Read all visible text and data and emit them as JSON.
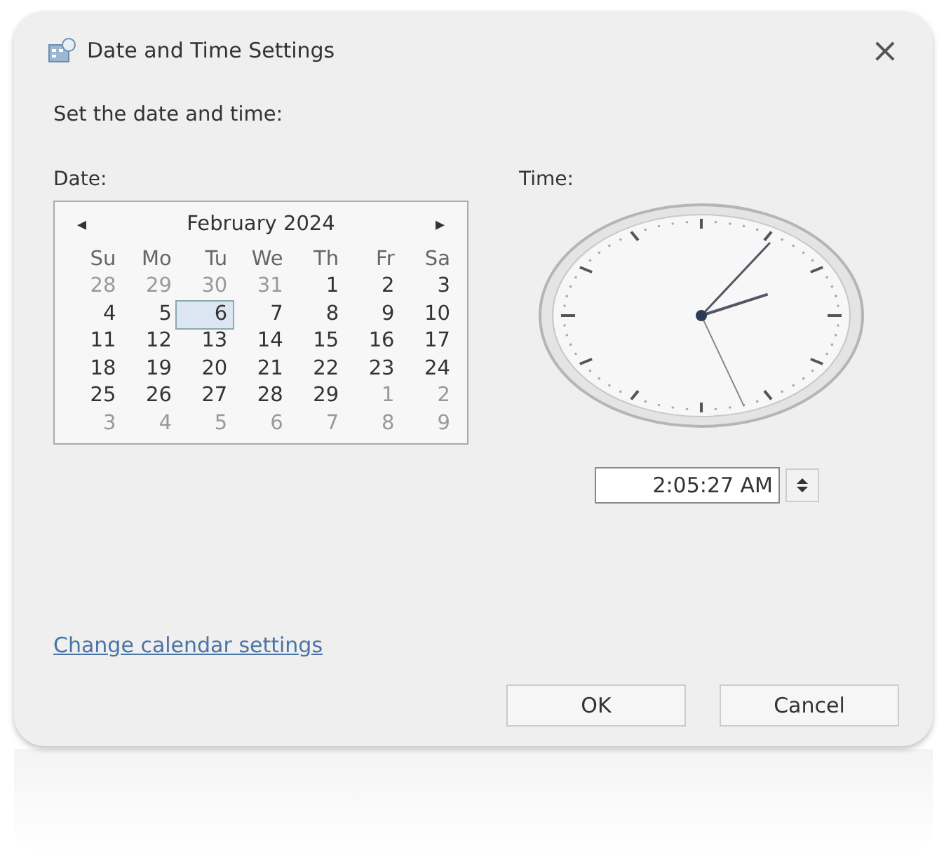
{
  "window": {
    "title": "Date and Time Settings",
    "close": "×"
  },
  "prompt": "Set the date and time:",
  "date": {
    "label": "Date:",
    "prev": "◂",
    "next": "▸",
    "month": "February 2024",
    "weekdays": [
      "Su",
      "Mo",
      "Tu",
      "We",
      "Th",
      "Fr",
      "Sa"
    ],
    "weeks": [
      [
        {
          "day": "28",
          "dimmed": true,
          "selected": false
        },
        {
          "day": "29",
          "dimmed": true,
          "selected": false
        },
        {
          "day": "30",
          "dimmed": true,
          "selected": false
        },
        {
          "day": "31",
          "dimmed": true,
          "selected": false
        },
        {
          "day": "1",
          "dimmed": false,
          "selected": false
        },
        {
          "day": "2",
          "dimmed": false,
          "selected": false
        },
        {
          "day": "3",
          "dimmed": false,
          "selected": false
        }
      ],
      [
        {
          "day": "4",
          "dimmed": false,
          "selected": false
        },
        {
          "day": "5",
          "dimmed": false,
          "selected": false
        },
        {
          "day": "6",
          "dimmed": false,
          "selected": true
        },
        {
          "day": "7",
          "dimmed": false,
          "selected": false
        },
        {
          "day": "8",
          "dimmed": false,
          "selected": false
        },
        {
          "day": "9",
          "dimmed": false,
          "selected": false
        },
        {
          "day": "10",
          "dimmed": false,
          "selected": false
        }
      ],
      [
        {
          "day": "11",
          "dimmed": false,
          "selected": false
        },
        {
          "day": "12",
          "dimmed": false,
          "selected": false
        },
        {
          "day": "13",
          "dimmed": false,
          "selected": false
        },
        {
          "day": "14",
          "dimmed": false,
          "selected": false
        },
        {
          "day": "15",
          "dimmed": false,
          "selected": false
        },
        {
          "day": "16",
          "dimmed": false,
          "selected": false
        },
        {
          "day": "17",
          "dimmed": false,
          "selected": false
        }
      ],
      [
        {
          "day": "18",
          "dimmed": false,
          "selected": false
        },
        {
          "day": "19",
          "dimmed": false,
          "selected": false
        },
        {
          "day": "20",
          "dimmed": false,
          "selected": false
        },
        {
          "day": "21",
          "dimmed": false,
          "selected": false
        },
        {
          "day": "22",
          "dimmed": false,
          "selected": false
        },
        {
          "day": "23",
          "dimmed": false,
          "selected": false
        },
        {
          "day": "24",
          "dimmed": false,
          "selected": false
        }
      ],
      [
        {
          "day": "25",
          "dimmed": false,
          "selected": false
        },
        {
          "day": "26",
          "dimmed": false,
          "selected": false
        },
        {
          "day": "27",
          "dimmed": false,
          "selected": false
        },
        {
          "day": "28",
          "dimmed": false,
          "selected": false
        },
        {
          "day": "29",
          "dimmed": false,
          "selected": false
        },
        {
          "day": "1",
          "dimmed": true,
          "selected": false
        },
        {
          "day": "2",
          "dimmed": true,
          "selected": false
        }
      ],
      [
        {
          "day": "3",
          "dimmed": true,
          "selected": false
        },
        {
          "day": "4",
          "dimmed": true,
          "selected": false
        },
        {
          "day": "5",
          "dimmed": true,
          "selected": false
        },
        {
          "day": "6",
          "dimmed": true,
          "selected": false
        },
        {
          "day": "7",
          "dimmed": true,
          "selected": false
        },
        {
          "day": "8",
          "dimmed": true,
          "selected": false
        },
        {
          "day": "9",
          "dimmed": true,
          "selected": false
        }
      ]
    ]
  },
  "time": {
    "label": "Time:",
    "value": "2:05:27 AM"
  },
  "link": "Change calendar settings",
  "buttons": [
    "OK",
    "Cancel"
  ]
}
